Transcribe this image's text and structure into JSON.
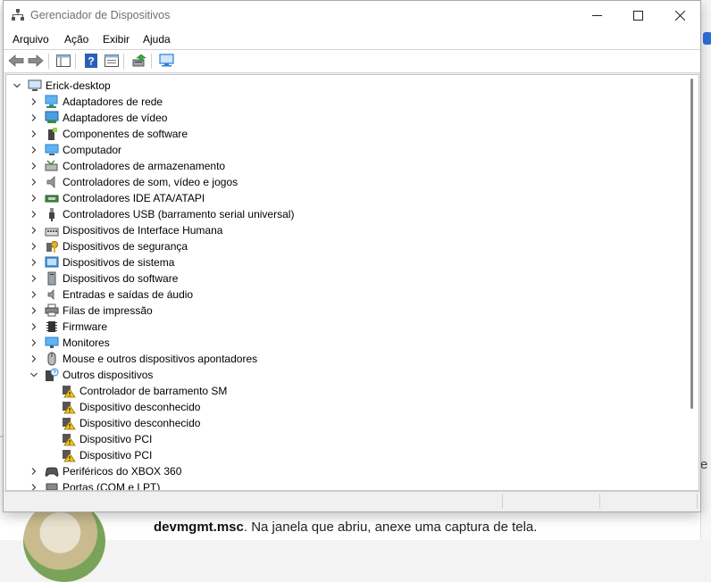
{
  "window": {
    "title": "Gerenciador de Dispositivos",
    "minimize_label": "—",
    "maximize_label": "☐",
    "close_label": "✕"
  },
  "menu": [
    "Arquivo",
    "Ação",
    "Exibir",
    "Ajuda"
  ],
  "tree": {
    "root": "Erick-desktop",
    "categories": [
      {
        "label": "Adaptadores de rede",
        "icon": "network-adapter-icon"
      },
      {
        "label": "Adaptadores de vídeo",
        "icon": "display-adapter-icon"
      },
      {
        "label": "Componentes de software",
        "icon": "software-component-icon"
      },
      {
        "label": "Computador",
        "icon": "computer-icon"
      },
      {
        "label": "Controladores de armazenamento",
        "icon": "storage-controller-icon"
      },
      {
        "label": "Controladores de som, vídeo e jogos",
        "icon": "speaker-icon"
      },
      {
        "label": "Controladores IDE ATA/ATAPI",
        "icon": "ide-controller-icon"
      },
      {
        "label": "Controladores USB (barramento serial universal)",
        "icon": "usb-icon"
      },
      {
        "label": "Dispositivos de Interface Humana",
        "icon": "hid-icon"
      },
      {
        "label": "Dispositivos de segurança",
        "icon": "security-key-icon"
      },
      {
        "label": "Dispositivos de sistema",
        "icon": "system-device-icon"
      },
      {
        "label": "Dispositivos do software",
        "icon": "software-device-icon"
      },
      {
        "label": "Entradas e saídas de áudio",
        "icon": "audio-io-icon"
      },
      {
        "label": "Filas de impressão",
        "icon": "printer-icon"
      },
      {
        "label": "Firmware",
        "icon": "firmware-chip-icon"
      },
      {
        "label": "Monitores",
        "icon": "monitor-icon"
      },
      {
        "label": "Mouse e outros dispositivos apontadores",
        "icon": "mouse-icon"
      }
    ],
    "expanded": {
      "label": "Outros dispositivos",
      "children": [
        "Controlador de barramento SM",
        "Dispositivo desconhecido",
        "Dispositivo desconhecido",
        "Dispositivo PCI",
        "Dispositivo PCI"
      ]
    },
    "after": [
      {
        "label": "Periféricos do XBOX 360",
        "icon": "gamepad-icon"
      },
      {
        "label": "Portas (COM e LPT)",
        "icon": "port-icon"
      }
    ]
  },
  "background": {
    "instruction_bold": "devmgmt.msc",
    "instruction_rest": ". Na janela que abriu, anexe uma captura de tela.",
    "edge_letter": "e"
  },
  "colors": {
    "warning": "#f5c518",
    "icon_blue": "#2a7fd4",
    "title_gray": "#707070"
  }
}
